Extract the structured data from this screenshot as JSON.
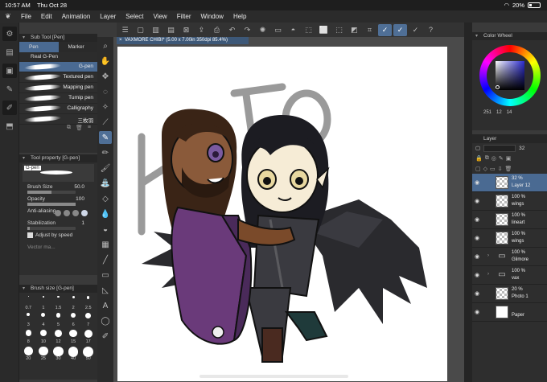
{
  "status": {
    "time": "10:57 AM",
    "date": "Thu Oct 28",
    "battery": "20%"
  },
  "menu": [
    "File",
    "Edit",
    "Animation",
    "Layer",
    "Select",
    "View",
    "Filter",
    "Window",
    "Help"
  ],
  "document_tab": "VAXMORE CHIBI* (5.00 x 7.00in 350dpi 85.4%)",
  "subtool": {
    "title": "Sub Tool [Pen]",
    "tabs": [
      "Pen",
      "Marker"
    ],
    "group": "Real G-Pen",
    "brushes": [
      "G-pen",
      "Textured pen",
      "Mapping pen",
      "Turnip pen",
      "Calligraphy",
      "三枚羽"
    ],
    "selected_index": 0
  },
  "tool_property": {
    "title": "Tool property [G-pen]",
    "preview_tag": "G-pen",
    "brush_size_label": "Brush Size",
    "brush_size_value": "50.0",
    "opacity_label": "Opacity",
    "opacity_value": "100",
    "antialias_label": "Anti-aliasing",
    "stabilization_label": "Stabilization",
    "stabilization_value": "1",
    "adjust_speed_label": "Adjust by speed",
    "vector_label": "Vector ma..."
  },
  "brush_size_panel": {
    "title": "Brush size [G-pen]",
    "sizes": [
      "0.7",
      "1",
      "1.5",
      "2",
      "2.5",
      "3",
      "4",
      "5",
      "6",
      "7",
      "8",
      "10",
      "12",
      "15",
      "17",
      "20",
      "25",
      "30",
      "40",
      "50"
    ]
  },
  "color_panel": {
    "title": "Color Wheel",
    "values": [
      "251",
      "12",
      "14"
    ]
  },
  "layer_panel": {
    "title": "Layer",
    "opacity_field": "32",
    "layers": [
      {
        "pct": "32 %",
        "name": "Layer 12",
        "type": "raster",
        "selected": true
      },
      {
        "pct": "100 %",
        "name": "wings",
        "type": "raster"
      },
      {
        "pct": "100 %",
        "name": "lineart",
        "type": "raster"
      },
      {
        "pct": "100 %",
        "name": "wings",
        "type": "raster"
      },
      {
        "pct": "100 %",
        "name": "Glimore",
        "type": "folder"
      },
      {
        "pct": "100 %",
        "name": "vax",
        "type": "folder"
      },
      {
        "pct": "20 %",
        "name": "Photo 1",
        "type": "raster"
      },
      {
        "pct": "",
        "name": "Paper",
        "type": "paper"
      }
    ]
  },
  "colors": {
    "accent": "#4a6a92",
    "bg": "#3a3a3a",
    "panel": "#2e2e2e"
  }
}
